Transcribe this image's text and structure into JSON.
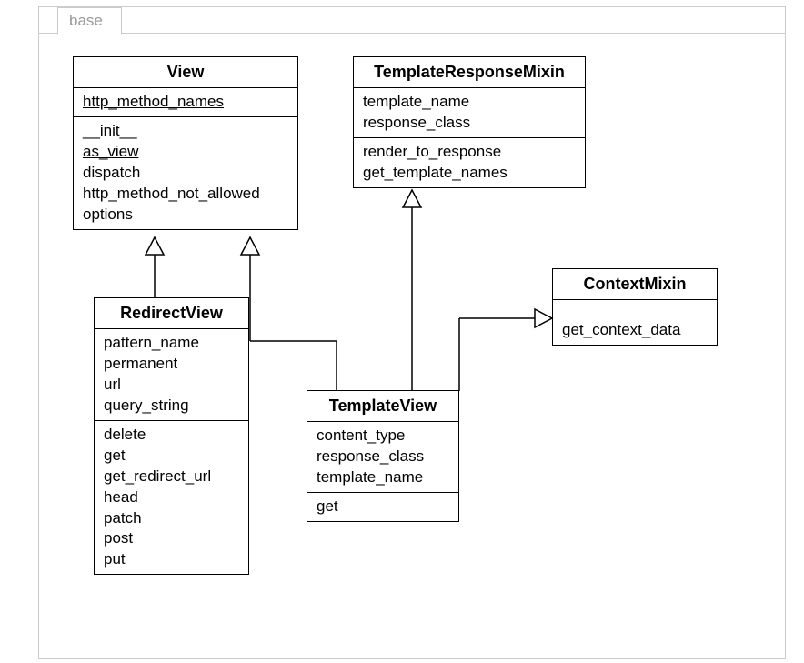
{
  "package": {
    "label": "base"
  },
  "classes": {
    "view": {
      "name": "View",
      "attributes": [
        "http_method_names"
      ],
      "attributes_underlined": [
        true
      ],
      "methods": [
        "__init__",
        "as_view",
        "dispatch",
        "http_method_not_allowed",
        "options"
      ],
      "methods_underlined": [
        false,
        true,
        false,
        false,
        false
      ]
    },
    "templateResponseMixin": {
      "name": "TemplateResponseMixin",
      "attributes": [
        "template_name",
        "response_class"
      ],
      "methods": [
        "render_to_response",
        "get_template_names"
      ]
    },
    "contextMixin": {
      "name": "ContextMixin",
      "attributes": [],
      "methods": [
        "get_context_data"
      ]
    },
    "redirectView": {
      "name": "RedirectView",
      "attributes": [
        "pattern_name",
        "permanent",
        "url",
        "query_string"
      ],
      "methods": [
        "delete",
        "get",
        "get_redirect_url",
        "head",
        "patch",
        "post",
        "put"
      ]
    },
    "templateView": {
      "name": "TemplateView",
      "attributes": [
        "content_type",
        "response_class",
        "template_name"
      ],
      "methods": [
        "get"
      ]
    }
  },
  "relationships": [
    {
      "from": "RedirectView",
      "to": "View",
      "type": "inheritance"
    },
    {
      "from": "TemplateView",
      "to": "View",
      "type": "inheritance"
    },
    {
      "from": "TemplateView",
      "to": "TemplateResponseMixin",
      "type": "inheritance"
    },
    {
      "from": "TemplateView",
      "to": "ContextMixin",
      "type": "inheritance"
    }
  ]
}
